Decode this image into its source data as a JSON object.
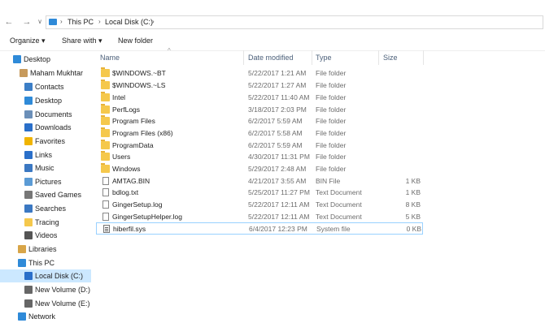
{
  "address": {
    "back_glyph": "←",
    "forward_glyph": "→",
    "up_glyph": "∨",
    "crumbs": [
      "This PC",
      "Local Disk (C:)"
    ],
    "separator": "›"
  },
  "commands": {
    "organize": "Organize ▾",
    "share": "Share with ▾",
    "new_folder": "New folder"
  },
  "nav": {
    "items": [
      {
        "label": "Desktop",
        "icon": "desktop-icon",
        "color": "#2f8ad8"
      },
      {
        "label": "Maham Mukhtar",
        "icon": "user-icon",
        "color": "#c79a5c"
      },
      {
        "label": "Contacts",
        "icon": "contacts-icon",
        "color": "#3c7ec6"
      },
      {
        "label": "Desktop",
        "icon": "desktop-icon",
        "color": "#2f8ad8"
      },
      {
        "label": "Documents",
        "icon": "documents-icon",
        "color": "#6b8fb8"
      },
      {
        "label": "Downloads",
        "icon": "download-icon",
        "color": "#2a6fc9"
      },
      {
        "label": "Favorites",
        "icon": "star-icon",
        "color": "#f0b400"
      },
      {
        "label": "Links",
        "icon": "link-icon",
        "color": "#2a6fc9"
      },
      {
        "label": "Music",
        "icon": "music-icon",
        "color": "#3b78c2"
      },
      {
        "label": "Pictures",
        "icon": "pictures-icon",
        "color": "#5b9bd5"
      },
      {
        "label": "Saved Games",
        "icon": "game-icon",
        "color": "#777777"
      },
      {
        "label": "Searches",
        "icon": "search-icon",
        "color": "#3b78c2"
      },
      {
        "label": "Tracing",
        "icon": "folder-icon",
        "color": "#f5c84c"
      },
      {
        "label": "Videos",
        "icon": "video-icon",
        "color": "#555555"
      },
      {
        "label": "Libraries",
        "icon": "libraries-icon",
        "color": "#d8a548"
      },
      {
        "label": "This PC",
        "icon": "computer-icon",
        "color": "#2f8ad8"
      },
      {
        "label": "Local Disk (C:)",
        "icon": "drive-icon",
        "color": "#2a6fc9"
      },
      {
        "label": "New Volume (D:)",
        "icon": "drive-icon",
        "color": "#666666"
      },
      {
        "label": "New Volume (E:)",
        "icon": "drive-icon",
        "color": "#666666"
      },
      {
        "label": "Network",
        "icon": "network-icon",
        "color": "#2f8ad8"
      }
    ]
  },
  "columns": {
    "name": "Name",
    "date": "Date modified",
    "type": "Type",
    "size": "Size",
    "sort_glyph": "^"
  },
  "files": [
    {
      "name": "$WINDOWS.~BT",
      "date": "5/22/2017 1:21 AM",
      "type": "File folder",
      "size": "",
      "icon": "folder-icon"
    },
    {
      "name": "$WINDOWS.~LS",
      "date": "5/22/2017 1:27 AM",
      "type": "File folder",
      "size": "",
      "icon": "folder-icon"
    },
    {
      "name": "Intel",
      "date": "5/22/2017 11:40 AM",
      "type": "File folder",
      "size": "",
      "icon": "folder-icon"
    },
    {
      "name": "PerfLogs",
      "date": "3/18/2017 2:03 PM",
      "type": "File folder",
      "size": "",
      "icon": "folder-icon"
    },
    {
      "name": "Program Files",
      "date": "6/2/2017 5:59 AM",
      "type": "File folder",
      "size": "",
      "icon": "folder-icon"
    },
    {
      "name": "Program Files (x86)",
      "date": "6/2/2017 5:58 AM",
      "type": "File folder",
      "size": "",
      "icon": "folder-icon"
    },
    {
      "name": "ProgramData",
      "date": "6/2/2017 5:59 AM",
      "type": "File folder",
      "size": "",
      "icon": "folder-icon"
    },
    {
      "name": "Users",
      "date": "4/30/2017 11:31 PM",
      "type": "File folder",
      "size": "",
      "icon": "folder-icon"
    },
    {
      "name": "Windows",
      "date": "5/29/2017 2:48 AM",
      "type": "File folder",
      "size": "",
      "icon": "folder-icon"
    },
    {
      "name": "AMTAG.BIN",
      "date": "4/21/2017 3:55 AM",
      "type": "BIN File",
      "size": "1 KB",
      "icon": "file-icon"
    },
    {
      "name": "bdlog.txt",
      "date": "5/25/2017 11:27 PM",
      "type": "Text Document",
      "size": "1 KB",
      "icon": "file-icon"
    },
    {
      "name": "GingerSetup.log",
      "date": "5/22/2017 12:11 AM",
      "type": "Text Document",
      "size": "8 KB",
      "icon": "file-icon"
    },
    {
      "name": "GingerSetupHelper.log",
      "date": "5/22/2017 12:11 AM",
      "type": "Text Document",
      "size": "5 KB",
      "icon": "file-icon"
    },
    {
      "name": "hiberfil.sys",
      "date": "6/4/2017 12:23 PM",
      "type": "System file",
      "size": "0 KB",
      "icon": "system-file-icon"
    }
  ],
  "selected_file_index": 13,
  "selected_nav_index": 16
}
